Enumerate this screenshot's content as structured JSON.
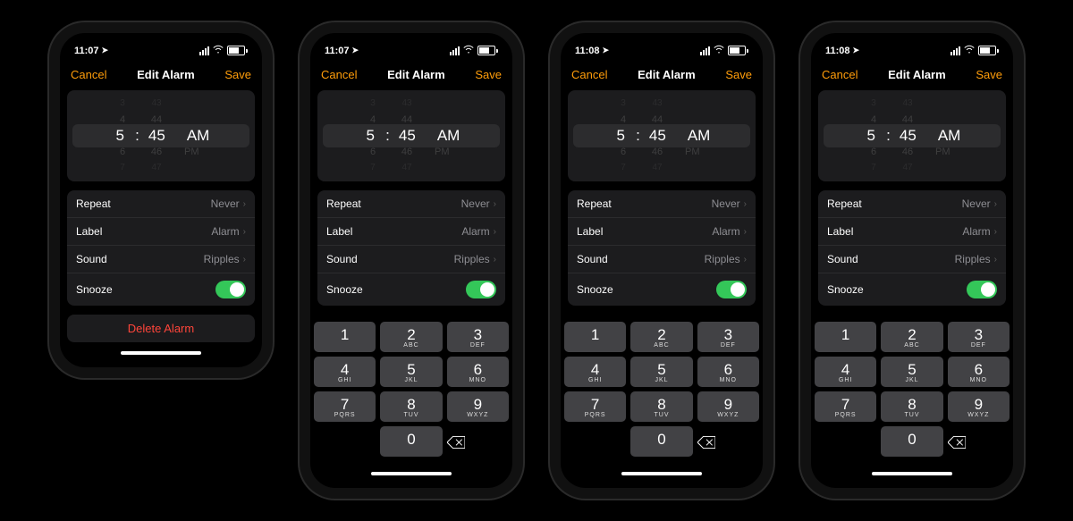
{
  "keypad": {
    "letters": {
      "2": "ABC",
      "3": "DEF",
      "4": "GHI",
      "5": "JKL",
      "6": "MNO",
      "7": "PQRS",
      "8": "TUV",
      "9": "WXYZ"
    }
  },
  "common": {
    "nav": {
      "cancel": "Cancel",
      "title": "Edit Alarm",
      "save": "Save"
    },
    "picker": {
      "rows": [
        {
          "h": "3",
          "m": "43"
        },
        {
          "h": "4",
          "m": "44"
        },
        {
          "h": "5",
          "m": "45",
          "a": "AM"
        },
        {
          "h": "6",
          "m": "46",
          "a": "PM"
        },
        {
          "h": "7",
          "m": "47"
        }
      ],
      "colon": ":"
    },
    "settings": {
      "repeat": {
        "label": "Repeat",
        "value": "Never"
      },
      "label": {
        "label": "Label",
        "value": "Alarm"
      },
      "sound": {
        "label": "Sound",
        "value": "Ripples"
      },
      "snooze": {
        "label": "Snooze",
        "on": true
      }
    },
    "delete_label": "Delete Alarm"
  },
  "phones": [
    {
      "time": "11:07",
      "show_delete": true,
      "show_keypad": false
    },
    {
      "time": "11:07",
      "show_delete": false,
      "show_keypad": true
    },
    {
      "time": "11:08",
      "show_delete": false,
      "show_keypad": true
    },
    {
      "time": "11:08",
      "show_delete": false,
      "show_keypad": true
    }
  ]
}
